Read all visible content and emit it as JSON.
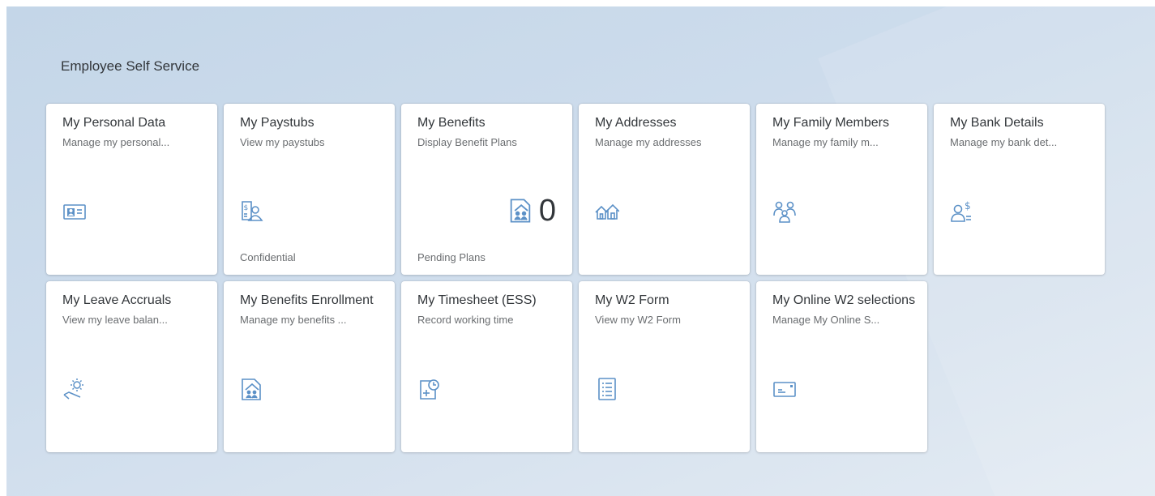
{
  "group": {
    "title": "Employee Self Service"
  },
  "tiles": [
    {
      "title": "My Personal Data",
      "subtitle": "Manage my personal...",
      "icon": "id-card-icon"
    },
    {
      "title": "My Paystubs",
      "subtitle": "View my paystubs",
      "icon": "paystub-person-icon",
      "footer": "Confidential"
    },
    {
      "title": "My Benefits",
      "subtitle": "Display Benefit Plans",
      "icon": "family-benefits-icon",
      "footer": "Pending Plans",
      "kpi": "0"
    },
    {
      "title": "My Addresses",
      "subtitle": "Manage my addresses",
      "icon": "houses-icon"
    },
    {
      "title": "My Family Members",
      "subtitle": "Manage my family m...",
      "icon": "family-members-icon"
    },
    {
      "title": "My Bank Details",
      "subtitle": "Manage my bank det...",
      "icon": "person-dollar-icon"
    },
    {
      "title": "My Leave Accruals",
      "subtitle": "View my leave balan...",
      "icon": "sun-lounger-icon"
    },
    {
      "title": "My Benefits Enrollment",
      "subtitle": "Manage my benefits ...",
      "icon": "family-benefits-icon"
    },
    {
      "title": "My Timesheet (ESS)",
      "subtitle": "Record working time",
      "icon": "timesheet-add-icon"
    },
    {
      "title": "My W2 Form",
      "subtitle": "View my W2 Form",
      "icon": "form-list-icon"
    },
    {
      "title": "My Online W2 selections",
      "subtitle": "Manage My Online S...",
      "icon": "card-form-icon"
    }
  ],
  "colors": {
    "icon": "#5c91c7",
    "title": "#32363a",
    "subtitle": "#6a6d70"
  }
}
